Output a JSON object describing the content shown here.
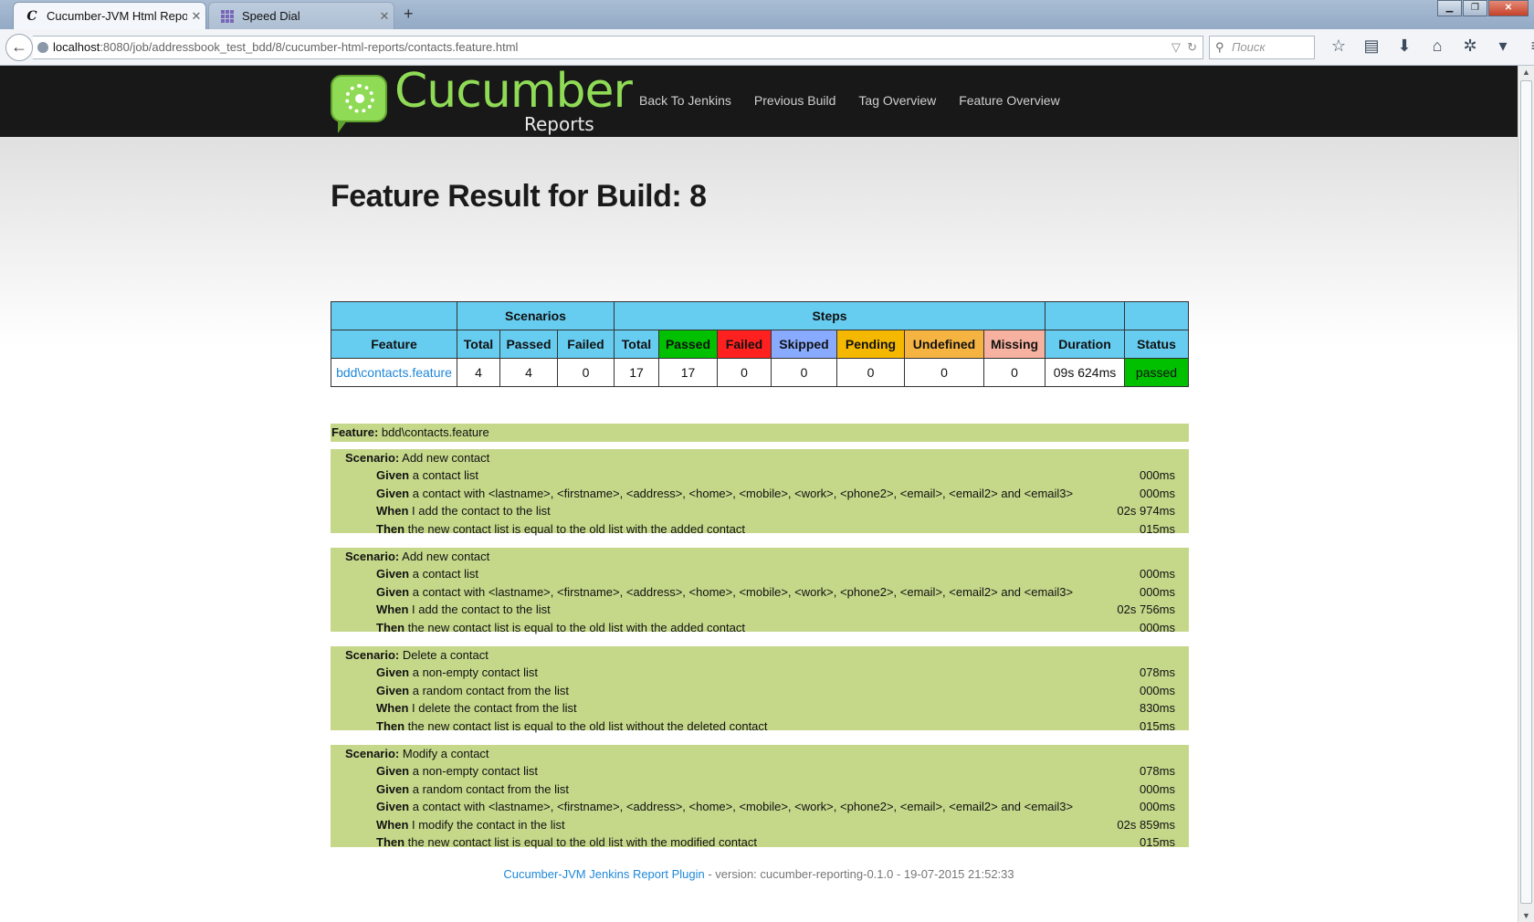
{
  "browser": {
    "tabs": [
      {
        "title": "Cucumber-JVM Html Repo...",
        "active": true,
        "favicon": "cucumber-c-icon"
      },
      {
        "title": "Speed Dial",
        "active": false,
        "favicon": "speed-dial-grid-icon"
      }
    ],
    "url_host": "localhost",
    "url_path": ":8080/job/addressbook_test_bdd/8/cucumber-html-reports/contacts.feature.html",
    "search_placeholder": "Поиск"
  },
  "header": {
    "logo_word": "Cucumber",
    "logo_sub": "Reports",
    "nav": [
      "Back To Jenkins",
      "Previous Build",
      "Tag Overview",
      "Feature Overview"
    ]
  },
  "page_title": "Feature Result for Build: 8",
  "stats": {
    "group_headers": {
      "scenarios": "Scenarios",
      "steps": "Steps"
    },
    "columns": [
      "Feature",
      "Total",
      "Passed",
      "Failed",
      "Total",
      "Passed",
      "Failed",
      "Skipped",
      "Pending",
      "Undefined",
      "Missing",
      "Duration",
      "Status"
    ],
    "row": [
      "bdd\\contacts.feature",
      "4",
      "4",
      "0",
      "17",
      "17",
      "0",
      "0",
      "0",
      "0",
      "0",
      "09s 624ms",
      "passed"
    ]
  },
  "feature": {
    "keyword": "Feature:",
    "name": "bdd\\contacts.feature"
  },
  "scenarios": [
    {
      "keyword": "Scenario:",
      "name": "Add new contact",
      "steps": [
        {
          "kw": "Given",
          "text": " a contact list",
          "dur": "000ms"
        },
        {
          "kw": "Given",
          "text": " a contact with <lastname>, <firstname>, <address>, <home>, <mobile>, <work>, <phone2>, <email>, <email2> and <email3>",
          "dur": "000ms"
        },
        {
          "kw": "When",
          "text": " I add the contact to the list",
          "dur": "02s 974ms"
        },
        {
          "kw": "Then",
          "text": " the new contact list is equal to the old list with the added contact",
          "dur": "015ms"
        }
      ]
    },
    {
      "keyword": "Scenario:",
      "name": "Add new contact",
      "steps": [
        {
          "kw": "Given",
          "text": " a contact list",
          "dur": "000ms"
        },
        {
          "kw": "Given",
          "text": " a contact with <lastname>, <firstname>, <address>, <home>, <mobile>, <work>, <phone2>, <email>, <email2> and <email3>",
          "dur": "000ms"
        },
        {
          "kw": "When",
          "text": " I add the contact to the list",
          "dur": "02s 756ms"
        },
        {
          "kw": "Then",
          "text": " the new contact list is equal to the old list with the added contact",
          "dur": "000ms"
        }
      ]
    },
    {
      "keyword": "Scenario:",
      "name": "Delete a contact",
      "steps": [
        {
          "kw": "Given",
          "text": " a non-empty contact list",
          "dur": "078ms"
        },
        {
          "kw": "Given",
          "text": " a random contact from the list",
          "dur": "000ms"
        },
        {
          "kw": "When",
          "text": " I delete the contact from the list",
          "dur": "830ms"
        },
        {
          "kw": "Then",
          "text": " the new contact list is equal to the old list without the deleted contact",
          "dur": "015ms"
        }
      ]
    },
    {
      "keyword": "Scenario:",
      "name": "Modify a contact",
      "steps": [
        {
          "kw": "Given",
          "text": " a non-empty contact list",
          "dur": "078ms"
        },
        {
          "kw": "Given",
          "text": " a random contact from the list",
          "dur": "000ms"
        },
        {
          "kw": "Given",
          "text": " a contact with <lastname>, <firstname>, <address>, <home>, <mobile>, <work>, <phone2>, <email>, <email2> and <email3>",
          "dur": "000ms"
        },
        {
          "kw": "When",
          "text": " I modify the contact in the list",
          "dur": "02s 859ms"
        },
        {
          "kw": "Then",
          "text": " the new contact list is equal to the old list with the modified contact",
          "dur": "015ms"
        }
      ]
    }
  ],
  "footer": {
    "link": "Cucumber-JVM Jenkins Report Plugin",
    "text": " - version: cucumber-reporting-0.1.0 - 19-07-2015 21:52:33"
  },
  "colors": {
    "header_bg": "#181818",
    "logo_green": "#8fdb56",
    "table_header": "#66ccf0",
    "passed": "#00c000",
    "failed": "#ff2020",
    "skipped": "#88aaff",
    "pending": "#f5b800",
    "undefined": "#f5b342",
    "missing": "#f7b1a0",
    "feature_bg": "#c5d88a",
    "link": "#1e88d8"
  }
}
